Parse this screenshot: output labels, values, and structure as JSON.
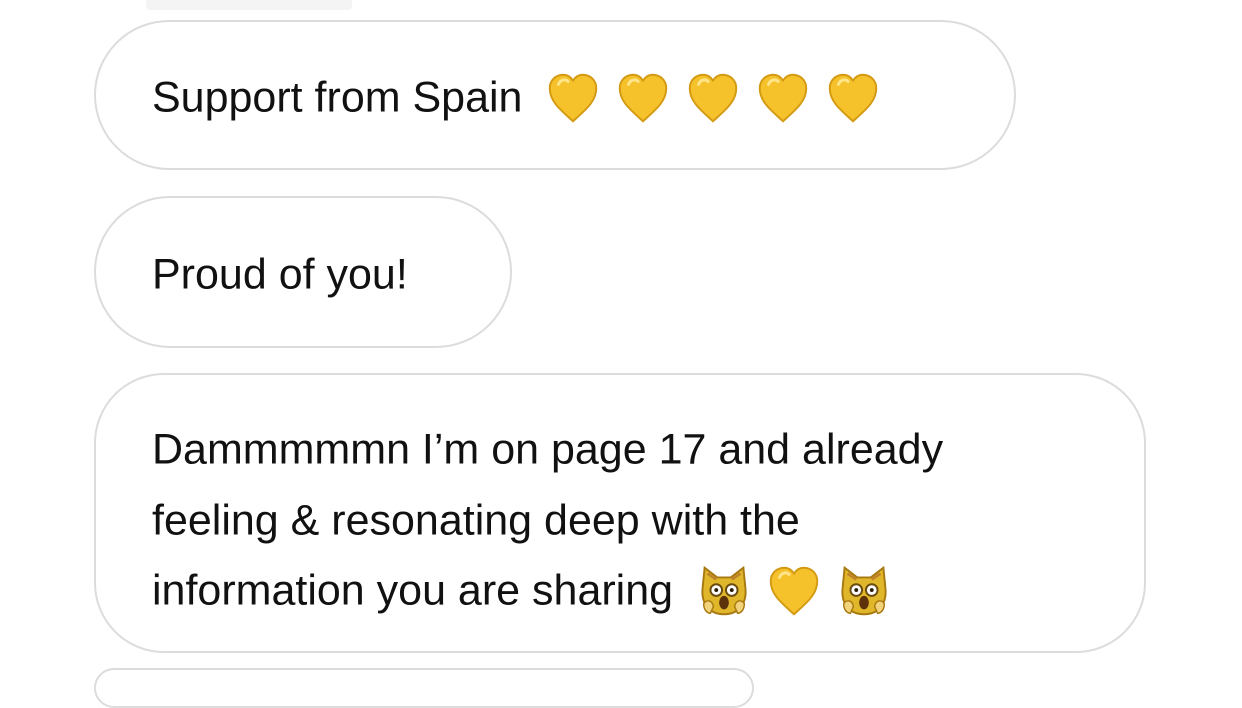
{
  "messages": [
    {
      "lines": [
        "Support from Spain"
      ],
      "emojis": [
        "yellow-heart-icon",
        "yellow-heart-icon",
        "yellow-heart-icon",
        "yellow-heart-icon",
        "yellow-heart-icon"
      ]
    },
    {
      "lines": [
        "Proud of you!"
      ],
      "emojis": []
    },
    {
      "lines": [
        "Dammmmmn I’m on page 17 and already",
        "feeling & resonating deep with the",
        "information you are sharing"
      ],
      "emojis": [
        "scream-cat-icon",
        "yellow-heart-icon",
        "scream-cat-icon"
      ]
    }
  ],
  "colors": {
    "bubble_border": "#dcdcdc",
    "text": "#111111",
    "heart_fill": "#f6c22c",
    "heart_stroke": "#d49a12",
    "cat_fill": "#e0b72b"
  }
}
